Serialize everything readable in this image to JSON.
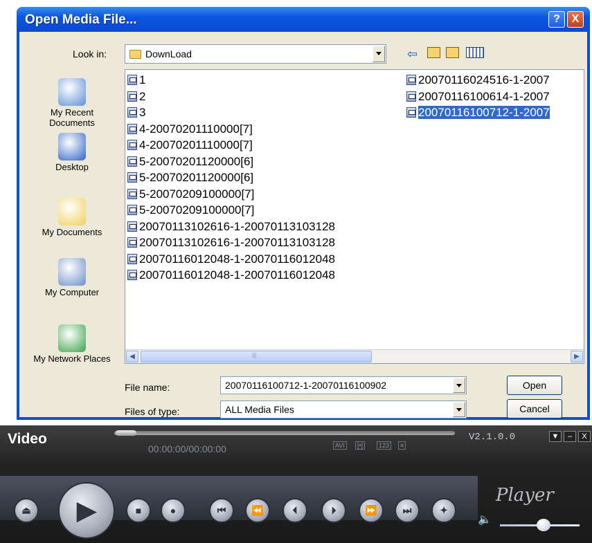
{
  "dialog": {
    "title": "Open Media File...",
    "help_glyph": "?",
    "close_glyph": "X",
    "look_in_label": "Look in:",
    "look_in_value": "DownLoad",
    "places": [
      {
        "label": "My Recent Documents",
        "icon": "recent-documents-icon"
      },
      {
        "label": "Desktop",
        "icon": "desktop-icon"
      },
      {
        "label": "My Documents",
        "icon": "my-documents-icon"
      },
      {
        "label": "My Computer",
        "icon": "my-computer-icon"
      },
      {
        "label": "My Network Places",
        "icon": "network-places-icon"
      }
    ],
    "files": [
      "1",
      "2",
      "3",
      "4-20070201110000[7]",
      "4-20070201110000[7]",
      "5-20070201120000[6]",
      "5-20070201120000[6]",
      "5-20070209100000[7]",
      "5-20070209100000[7]",
      "20070113102616-1-20070113103128",
      "20070113102616-1-20070113103128",
      "20070116012048-1-20070116012048",
      "20070116012048-1-20070116012048",
      "20070116024516-1-2007",
      "20070116100614-1-2007",
      "20070116100712-1-2007"
    ],
    "selected_index": 15,
    "file_name_label": "File name:",
    "file_name_value": "20070116100712-1-20070116100902",
    "file_type_label": "Files of type:",
    "file_type_value": "ALL Media Files",
    "open_label": "Open",
    "cancel_label": "Cancel"
  },
  "player": {
    "brand": "Video",
    "time": "00:00:00/00:00:00",
    "version": "V2.1.0.0",
    "script_label": "Player",
    "mini_labels": [
      "AVI",
      "[•]",
      "123"
    ],
    "buttons": [
      "eject",
      "play",
      "stop",
      "record",
      "first",
      "rewind",
      "prev-frame",
      "next-frame",
      "fast-forward",
      "last",
      "snapshot"
    ],
    "volume_level": 0.55
  }
}
